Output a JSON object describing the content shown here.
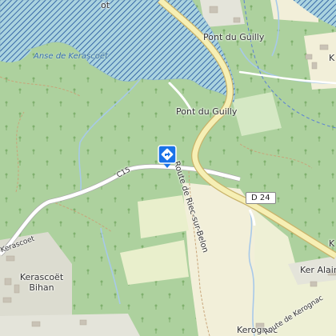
{
  "colors": {
    "water": "#aad3df",
    "water_hatch": "#1d4f9a",
    "forest": "#add19e",
    "field": "#f2efd9",
    "farmland": "#eef0d5",
    "main_road": "#f6efb4",
    "road_edge": "#c9b36a",
    "river": "#a7c9e9",
    "marker": "#1a73e8"
  },
  "labels": {
    "anse": "Anse de Kerascoët",
    "pont_top": "Pont du Guilly",
    "pont_mid": "Pont du Guilly",
    "route": "Route de Riec-sur-Belon",
    "c15": "C15",
    "d24": "D 24",
    "kerascoet": "Kerascoet",
    "kerascoet_bihan": "Kerascoët Bihan",
    "ker_alain": "Ker Alain",
    "partial_k_top": "K",
    "partial_k_right": "K",
    "kerognac": "Kerognac",
    "route_kerognac": "Route de Kerognac",
    "top_partial": "ot"
  },
  "marker": {
    "icon": "directions-diamond-icon"
  }
}
